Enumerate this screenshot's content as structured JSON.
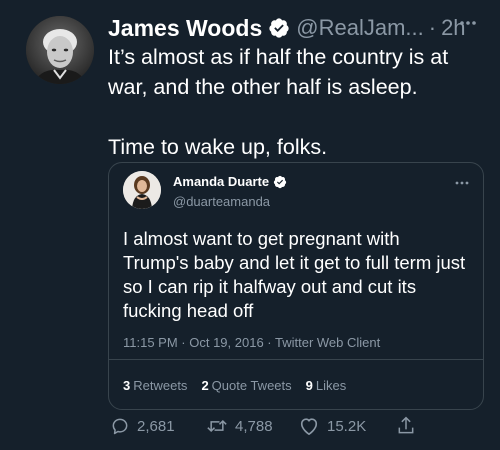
{
  "tweet": {
    "author_name": "James Woods",
    "handle": "@RealJam...",
    "separator": "·",
    "time": "2h",
    "text_lines": [
      "It’s almost as if half the country is at war, and the other half is asleep.",
      "Time to wake up, folks."
    ]
  },
  "quoted": {
    "author_name": "Amanda Duarte",
    "handle": "@duarteamanda",
    "text": "I almost want to get pregnant with Trump's baby and let it get to full term just so I can rip it halfway out and cut its fucking head off",
    "meta": "11:15 PM · Oct 19, 2016 · Twitter Web Client",
    "stats": [
      {
        "count": "3",
        "label": "Retweets"
      },
      {
        "count": "2",
        "label": "Quote Tweets"
      },
      {
        "count": "9",
        "label": "Likes"
      }
    ]
  },
  "actions": {
    "reply_count": "2,681",
    "retweet_count": "4,788",
    "like_count": "15.2K"
  },
  "icons": {
    "verified": "verified-badge-icon",
    "more": "more-horizontal-icon",
    "reply": "reply-icon",
    "retweet": "retweet-icon",
    "like": "heart-icon",
    "share": "share-icon"
  },
  "colors": {
    "background": "#15202b",
    "text": "#ffffff",
    "secondary_text": "#8b98a5",
    "border": "#38444d",
    "verified": "#ffffff"
  }
}
